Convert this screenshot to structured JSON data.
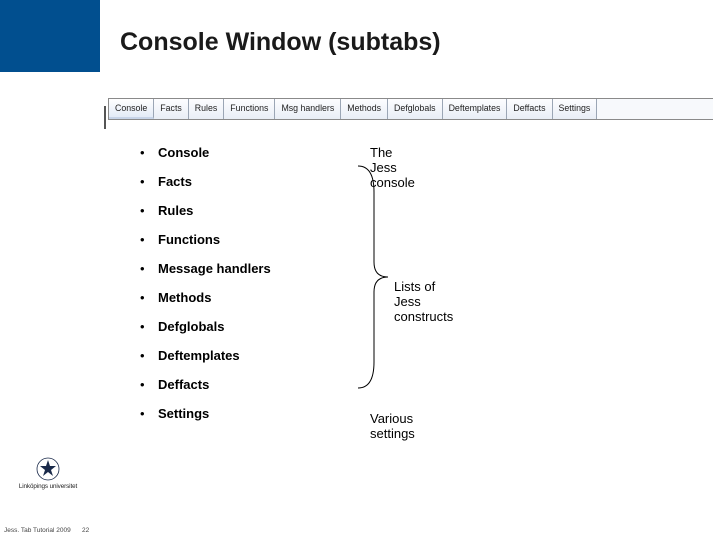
{
  "title": "Console Window (subtabs)",
  "tabs": [
    "Console",
    "Facts",
    "Rules",
    "Functions",
    "Msg handlers",
    "Methods",
    "Defglobals",
    "Deftemplates",
    "Deffacts",
    "Settings"
  ],
  "bullets": [
    "Console",
    "Facts",
    "Rules",
    "Functions",
    "Message handlers",
    "Methods",
    "Defglobals",
    "Deftemplates",
    "Deffacts",
    "Settings"
  ],
  "annotations": {
    "console": "The Jess console",
    "constructs": "Lists of Jess constructs",
    "settings": "Various settings"
  },
  "footer": {
    "text": "Jess. Tab Tutorial 2009",
    "page": "22",
    "org": "Linköpings universitet"
  }
}
